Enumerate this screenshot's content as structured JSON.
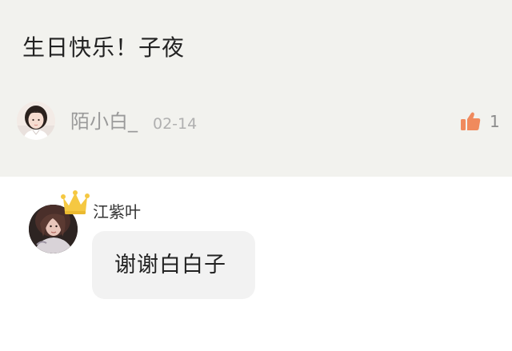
{
  "comment": {
    "text": "生日快乐！子夜",
    "author": {
      "avatar_icon": "girl-portrait-avatar",
      "name": "陌小白_",
      "date": "02-14"
    },
    "likes": {
      "icon": "thumbs-up-icon",
      "count": "1",
      "color": "#f08a5d"
    }
  },
  "reply": {
    "author": {
      "avatar_icon": "dark-portrait-avatar",
      "badge_icon": "crown-icon",
      "badge_color": "#f5c842",
      "name": "江紫叶"
    },
    "text": "谢谢白白子"
  },
  "colors": {
    "card_background": "#f2f2ee",
    "bubble_background": "#f2f2f2",
    "like_accent": "#f08a5d"
  }
}
